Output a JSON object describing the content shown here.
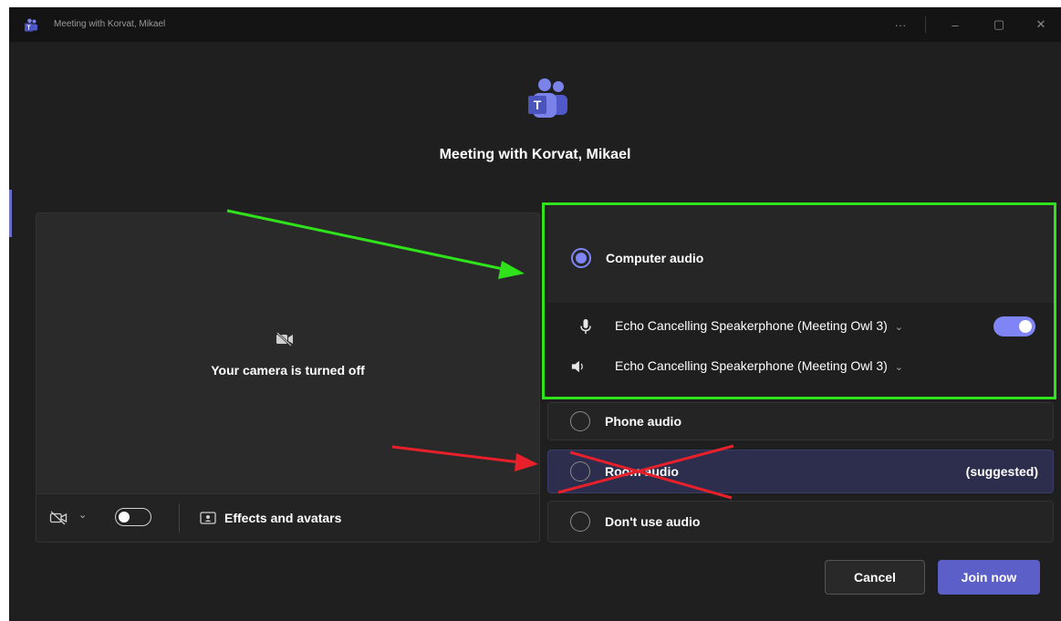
{
  "window": {
    "title": "Meeting with Korvat, Mikael",
    "more_glyph": "···",
    "minimize_glyph": "–",
    "maximize_glyph": "▢",
    "close_glyph": "✕"
  },
  "header": {
    "app_icon": "teams-logo-icon",
    "meeting_title": "Meeting with Korvat, Mikael"
  },
  "preview": {
    "camera_off_icon": "camera-off-icon",
    "camera_off_text": "Your camera is turned off",
    "toolbar": {
      "camera_icon": "camera-off-icon",
      "chevron": "⌄",
      "camera_toggle": "off",
      "effects_icon": "effects-icon",
      "effects_label": "Effects and avatars"
    }
  },
  "audio": {
    "computer_audio": {
      "label": "Computer audio",
      "selected": true,
      "microphone": {
        "icon": "microphone-icon",
        "device": "Echo Cancelling Speakerphone (Meeting Owl 3)",
        "chevron": "⌄",
        "toggle": "on"
      },
      "speaker": {
        "icon": "speaker-icon",
        "device": "Echo Cancelling Speakerphone (Meeting Owl 3)",
        "chevron": "⌄"
      }
    },
    "phone_audio": {
      "label": "Phone audio",
      "selected": false
    },
    "room_audio": {
      "label": "Room audio",
      "suggested_tag": "(suggested)",
      "selected": false
    },
    "no_audio": {
      "label": "Don't use audio",
      "selected": false
    }
  },
  "actions": {
    "cancel_label": "Cancel",
    "join_label": "Join now"
  },
  "annotations": {
    "green_arrow_color": "#2fe21b",
    "red_mark_color": "#e8202a",
    "highlight_frame_color": "#2fe21b"
  }
}
